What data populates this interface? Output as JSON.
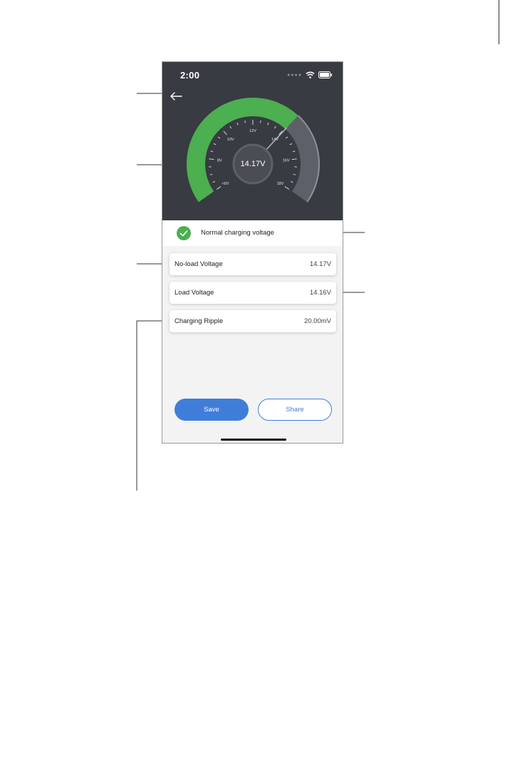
{
  "status_bar": {
    "time": "2:00"
  },
  "gauge": {
    "readout": "14.17V",
    "ticks": [
      "<6V",
      "8V",
      "10V",
      "12V",
      "14V",
      "16V",
      "18V"
    ],
    "colors": {
      "active": "#4caf50",
      "inactive": "#5d6068",
      "background": "#383b42"
    }
  },
  "status": {
    "message": "Normal charging voltage"
  },
  "measurements": [
    {
      "label": "No-load Voltage",
      "value": "14.17V"
    },
    {
      "label": "Load Voltage",
      "value": "14.16V"
    },
    {
      "label": "Charging Ripple",
      "value": "20.00mV"
    }
  ],
  "actions": {
    "save": "Save",
    "share": "Share"
  },
  "colors": {
    "accent": "#3f7ed8",
    "success": "#4caf50"
  }
}
